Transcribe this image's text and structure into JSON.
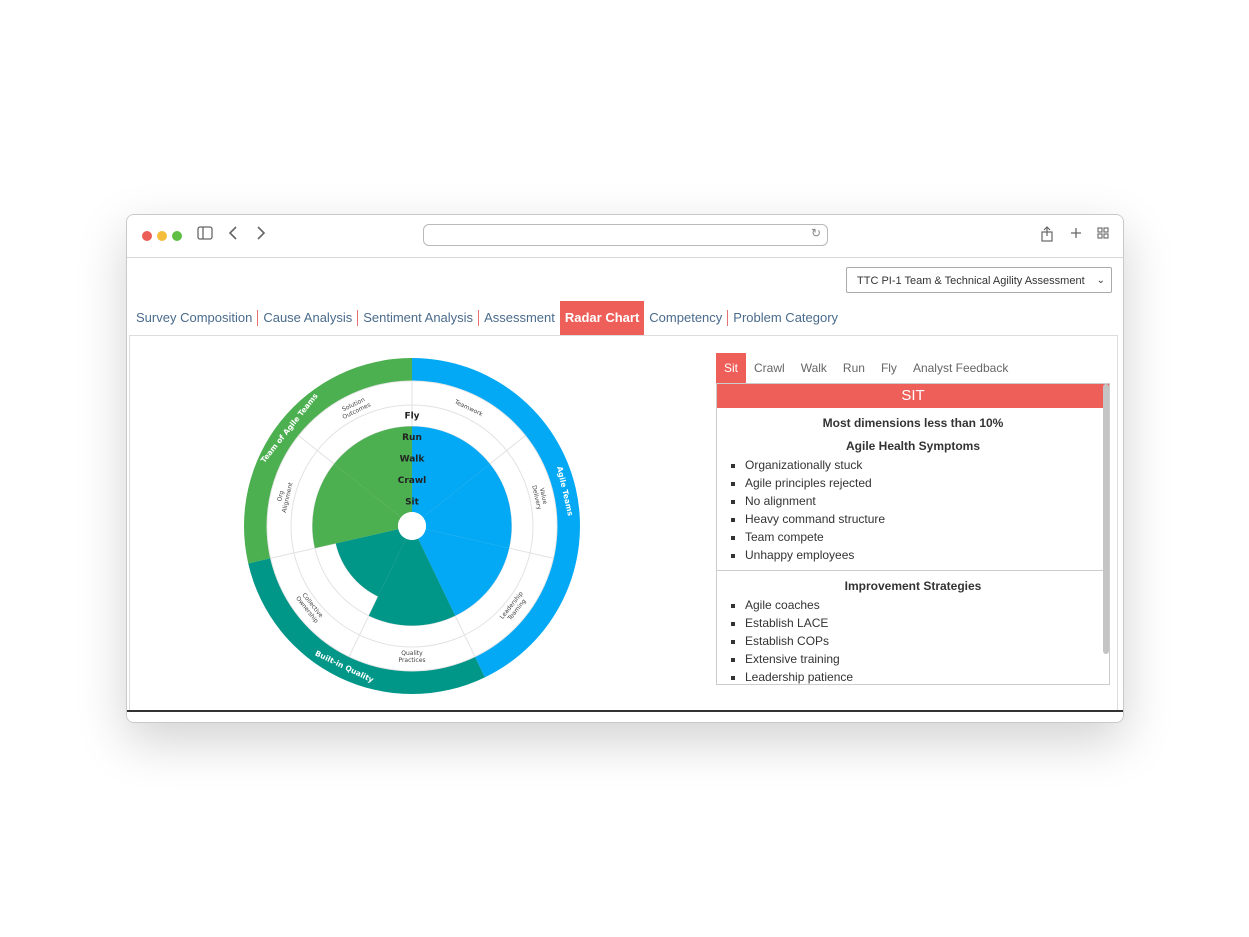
{
  "dropdown": {
    "selected": "TTC PI-1 Team & Technical Agility Assessment"
  },
  "nav_tabs": [
    "Survey Composition",
    "Cause Analysis",
    "Sentiment Analysis",
    "Assessment",
    "Radar Chart",
    "Competency",
    "Problem Category"
  ],
  "active_nav_tab": "Radar Chart",
  "colors": {
    "accent": "#ef5f59",
    "agile_teams": "#03a9f4",
    "team_of_agile_teams": "#4caf50",
    "built_in_quality": "#009688"
  },
  "chart_data": {
    "type": "sunburst-radar",
    "rings": [
      "Sit",
      "Crawl",
      "Walk",
      "Run",
      "Fly"
    ],
    "outer_categories": [
      {
        "name": "Agile Teams",
        "color": "#03a9f4",
        "dimensions": [
          "Teamwork",
          "Value Delivery",
          "Leadership Teaming"
        ]
      },
      {
        "name": "Built-in Quality",
        "color": "#009688",
        "dimensions": [
          "Quality Practices",
          "Collective Ownership"
        ]
      },
      {
        "name": "Team of Agile Teams",
        "color": "#4caf50",
        "dimensions": [
          "Org Alignment",
          "Solution Outcomes"
        ]
      }
    ],
    "dimension_levels": [
      {
        "dimension": "Teamwork",
        "level": 4
      },
      {
        "dimension": "Value Delivery",
        "level": 4
      },
      {
        "dimension": "Leadership Teaming",
        "level": 4
      },
      {
        "dimension": "Quality Practices",
        "level": 4
      },
      {
        "dimension": "Collective Ownership",
        "level": 3
      },
      {
        "dimension": "Org Alignment",
        "level": 4
      },
      {
        "dimension": "Solution Outcomes",
        "level": 4
      }
    ]
  },
  "sub_tabs": [
    "Sit",
    "Crawl",
    "Walk",
    "Run",
    "Fly",
    "Analyst Feedback"
  ],
  "active_sub_tab": "Sit",
  "detail": {
    "header": "SIT",
    "summary": "Most dimensions less than 10%",
    "symptoms_title": "Agile Health Symptoms",
    "symptoms": [
      "Organizationally stuck",
      "Agile principles rejected",
      "No alignment",
      "Heavy command structure",
      "Team compete",
      "Unhappy employees"
    ],
    "strategies_title": "Improvement Strategies",
    "strategies": [
      "Agile coaches",
      "Establish LACE",
      "Establish COPs",
      "Extensive training",
      "Leadership patience"
    ]
  }
}
